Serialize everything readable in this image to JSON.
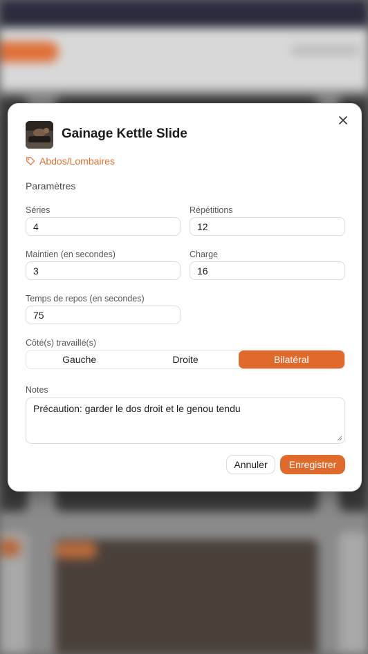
{
  "dialog": {
    "title": "Gainage Kettle Slide",
    "tag": "Abdos/Lombaires",
    "section_title": "Paramètres",
    "fields": {
      "series": {
        "label": "Séries",
        "value": "4"
      },
      "repetitions": {
        "label": "Répétitions",
        "value": "12"
      },
      "maintien": {
        "label": "Maintien (en secondes)",
        "value": "3"
      },
      "charge": {
        "label": "Charge",
        "value": "16"
      },
      "repos": {
        "label": "Temps de repos (en secondes)",
        "value": "75"
      }
    },
    "side": {
      "label": "Côté(s) travaillé(s)",
      "options": [
        "Gauche",
        "Droite",
        "Bilatéral"
      ],
      "selected": "Bilatéral"
    },
    "notes": {
      "label": "Notes",
      "value": "Précaution: garder le dos droit et le genou tendu"
    },
    "buttons": {
      "cancel": "Annuler",
      "save": "Enregistrer"
    }
  },
  "colors": {
    "accent": "#e06a2c",
    "tag": "#e07030"
  },
  "icons": {
    "close": "close-icon",
    "tag": "tag-icon"
  }
}
